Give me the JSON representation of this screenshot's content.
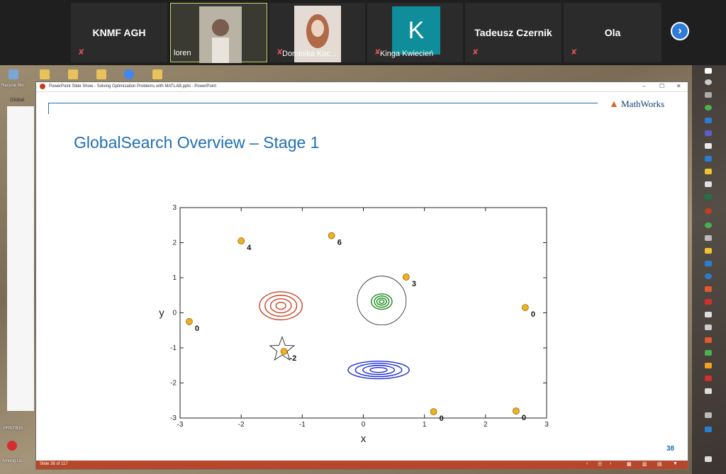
{
  "participants": [
    {
      "name": "KNMF AGH"
    },
    {
      "caption": "loren"
    },
    {
      "caption": "Dominika Koc..."
    },
    {
      "initial": "K",
      "caption": "Kinga Kwiecień"
    },
    {
      "name": "Tadeusz Czernik"
    },
    {
      "name": "Ola"
    }
  ],
  "mic_icon": "mic-off-icon",
  "next_icon": "chevron-right-icon",
  "next_glyph": "›",
  "desktop": {
    "recycle_bin": "Recycle Bin",
    "left_panel_label": "Global",
    "bottom_label_1": "PRNTB3S",
    "bottom_label_2": "Among Us"
  },
  "ppt": {
    "window_title": "PowerPoint Slide Show - Solving Optimization Problems with MATLAB.pptx - PowerPoint",
    "minimize": "–",
    "maximize": "☐",
    "close": "✕",
    "status_text": "Slide 38 of 117",
    "controls": [
      "‹",
      "☰",
      "›",
      "▦",
      "▥",
      "▤",
      "▼"
    ]
  },
  "slide": {
    "logo_text": "MathWorks",
    "title": "GlobalSearch Overview – Stage 1",
    "number": "38"
  },
  "chart_data": {
    "type": "scatter",
    "xlabel": "x",
    "ylabel": "y",
    "xlim": [
      -3,
      3
    ],
    "ylim": [
      -3,
      3
    ],
    "xticks": [
      -3,
      -2,
      -1,
      0,
      1,
      2,
      3
    ],
    "yticks": [
      -3,
      -2,
      -1,
      0,
      1,
      2,
      3
    ],
    "grid": false,
    "points": [
      {
        "x": -2.0,
        "y": 2.05,
        "label": "4"
      },
      {
        "x": -0.52,
        "y": 2.2,
        "label": "6"
      },
      {
        "x": 0.7,
        "y": 1.02,
        "label": "3"
      },
      {
        "x": -2.85,
        "y": -0.25,
        "label": "0"
      },
      {
        "x": 2.65,
        "y": 0.15,
        "label": "0"
      },
      {
        "x": -1.3,
        "y": -1.1,
        "label": "-2"
      },
      {
        "x": 1.15,
        "y": -2.82,
        "label": "0"
      },
      {
        "x": 2.5,
        "y": -2.8,
        "label": "0"
      }
    ],
    "star": {
      "x": -1.33,
      "y": -1.05
    },
    "circle": {
      "x": 0.3,
      "y": 0.35,
      "r": 0.4
    },
    "contours": [
      {
        "cx": -1.35,
        "cy": 0.2,
        "rx": [
          0.35,
          0.26,
          0.17,
          0.08
        ],
        "ry": [
          0.4,
          0.3,
          0.2,
          0.1
        ],
        "color": "#cc4125"
      },
      {
        "cx": 0.3,
        "cy": 0.32,
        "rx": [
          0.17,
          0.12,
          0.08,
          0.04
        ],
        "ry": [
          0.22,
          0.16,
          0.1,
          0.05
        ],
        "color": "#1e8c1e"
      },
      {
        "cx": 0.25,
        "cy": -1.63,
        "rx": [
          0.5,
          0.38,
          0.26,
          0.14
        ],
        "ry": [
          0.25,
          0.19,
          0.13,
          0.07
        ],
        "color": "#1c2bd6"
      }
    ],
    "point_color": "#f2b01e"
  }
}
